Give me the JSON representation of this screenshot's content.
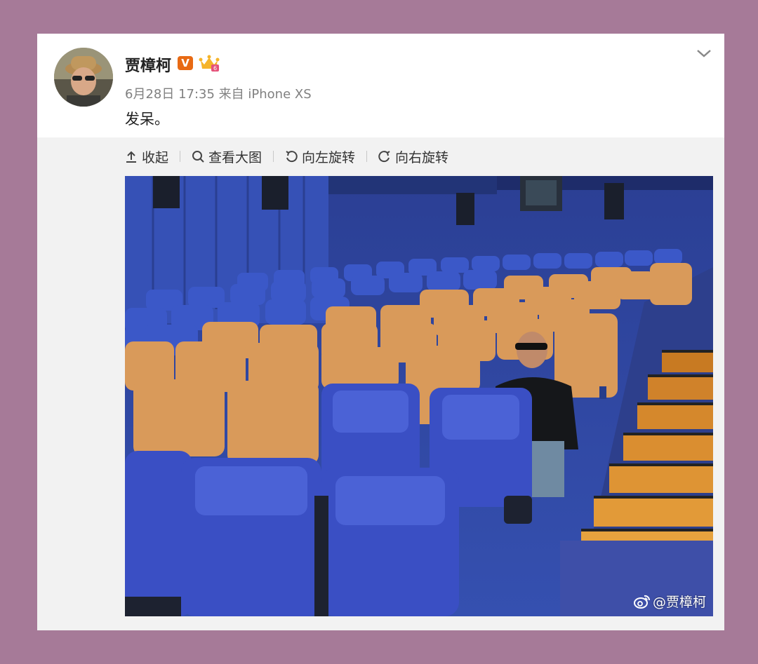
{
  "post": {
    "username": "贾樟柯",
    "verified_badge": "V",
    "meta": "6月28日 17:35 来自 iPhone XS",
    "text": "发呆。"
  },
  "toolbar": {
    "collapse_label": "收起",
    "view_large_label": "查看大图",
    "rotate_left_label": "向左旋转",
    "rotate_right_label": "向右旋转"
  },
  "photo": {
    "watermark": "@贾樟柯"
  },
  "icons": {
    "expand": "chevron-down-icon",
    "collapse": "arrow-up-icon",
    "view_large": "magnifier-icon",
    "rotate_left": "rotate-left-icon",
    "rotate_right": "rotate-right-icon",
    "watermark": "weibo-logo-icon"
  },
  "colors": {
    "frame_background": "#a67a98",
    "verified_badge": "#e86a14",
    "seat_blue": "#3a4fc4",
    "seat_orange": "#d99a5a"
  }
}
